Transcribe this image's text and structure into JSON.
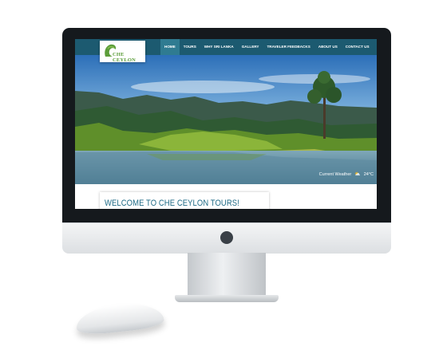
{
  "site": {
    "logo_text": "CHE CEYLON",
    "nav": {
      "items": [
        {
          "label": "HOME",
          "active": true
        },
        {
          "label": "TOURS",
          "active": false
        },
        {
          "label": "WHY SRI LANKA",
          "active": false
        },
        {
          "label": "GALLERY",
          "active": false
        },
        {
          "label": "TRAVELER FEEDBACKS",
          "active": false
        },
        {
          "label": "ABOUT US",
          "active": false
        },
        {
          "label": "CONTACT US",
          "active": false
        }
      ]
    },
    "hero": {
      "weather_label": "Current Weather",
      "weather_icon": "cloud-sun-icon",
      "temperature": "24°C"
    },
    "welcome_title": "WELCOME TO CHE CEYLON TOURS!"
  },
  "colors": {
    "navbar": "#1c5a70",
    "nav_active": "#2f7b91",
    "heading": "#1f6b86",
    "logo_green": "#5c9d3a"
  }
}
